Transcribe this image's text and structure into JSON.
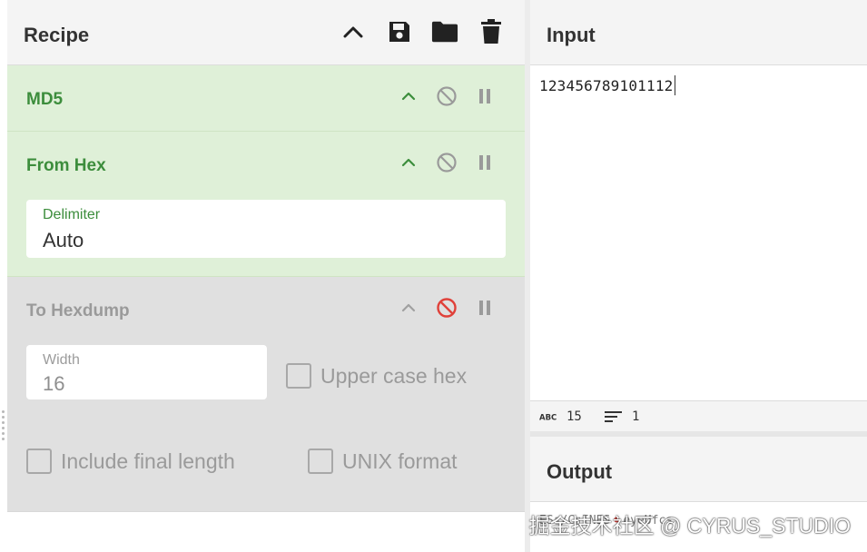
{
  "recipe": {
    "title": "Recipe",
    "header_icons": [
      "chevron-up-icon",
      "save-icon",
      "folder-icon",
      "trash-icon"
    ],
    "operations": [
      {
        "name": "MD5",
        "state": "enabled"
      },
      {
        "name": "From Hex",
        "state": "enabled",
        "fields": {
          "delimiter": {
            "label": "Delimiter",
            "value": "Auto"
          }
        }
      },
      {
        "name": "To Hexdump",
        "state": "disabled",
        "fields": {
          "width": {
            "label": "Width",
            "value": "16"
          },
          "upper_case_hex": {
            "label": "Upper case hex",
            "checked": false
          },
          "include_final_length": {
            "label": "Include final length",
            "checked": false
          },
          "unix_format": {
            "label": "UNIX format",
            "checked": false
          }
        }
      }
    ]
  },
  "input": {
    "title": "Input",
    "text": "123456789101112",
    "status": {
      "length": "15",
      "lines": "1"
    }
  },
  "output": {
    "title": "Output",
    "text_left": "ES▯/C▯INES",
    "text_right": "eyeUfcs"
  },
  "watermark": "掘金技术社区 @ CYRUS_STUDIO",
  "colors": {
    "enabled_op_bg": "#dff0d8",
    "enabled_op_text": "#3c8d3c",
    "disabled_op_bg": "#e0e0e0",
    "disable_icon_active": "#e0413a"
  }
}
